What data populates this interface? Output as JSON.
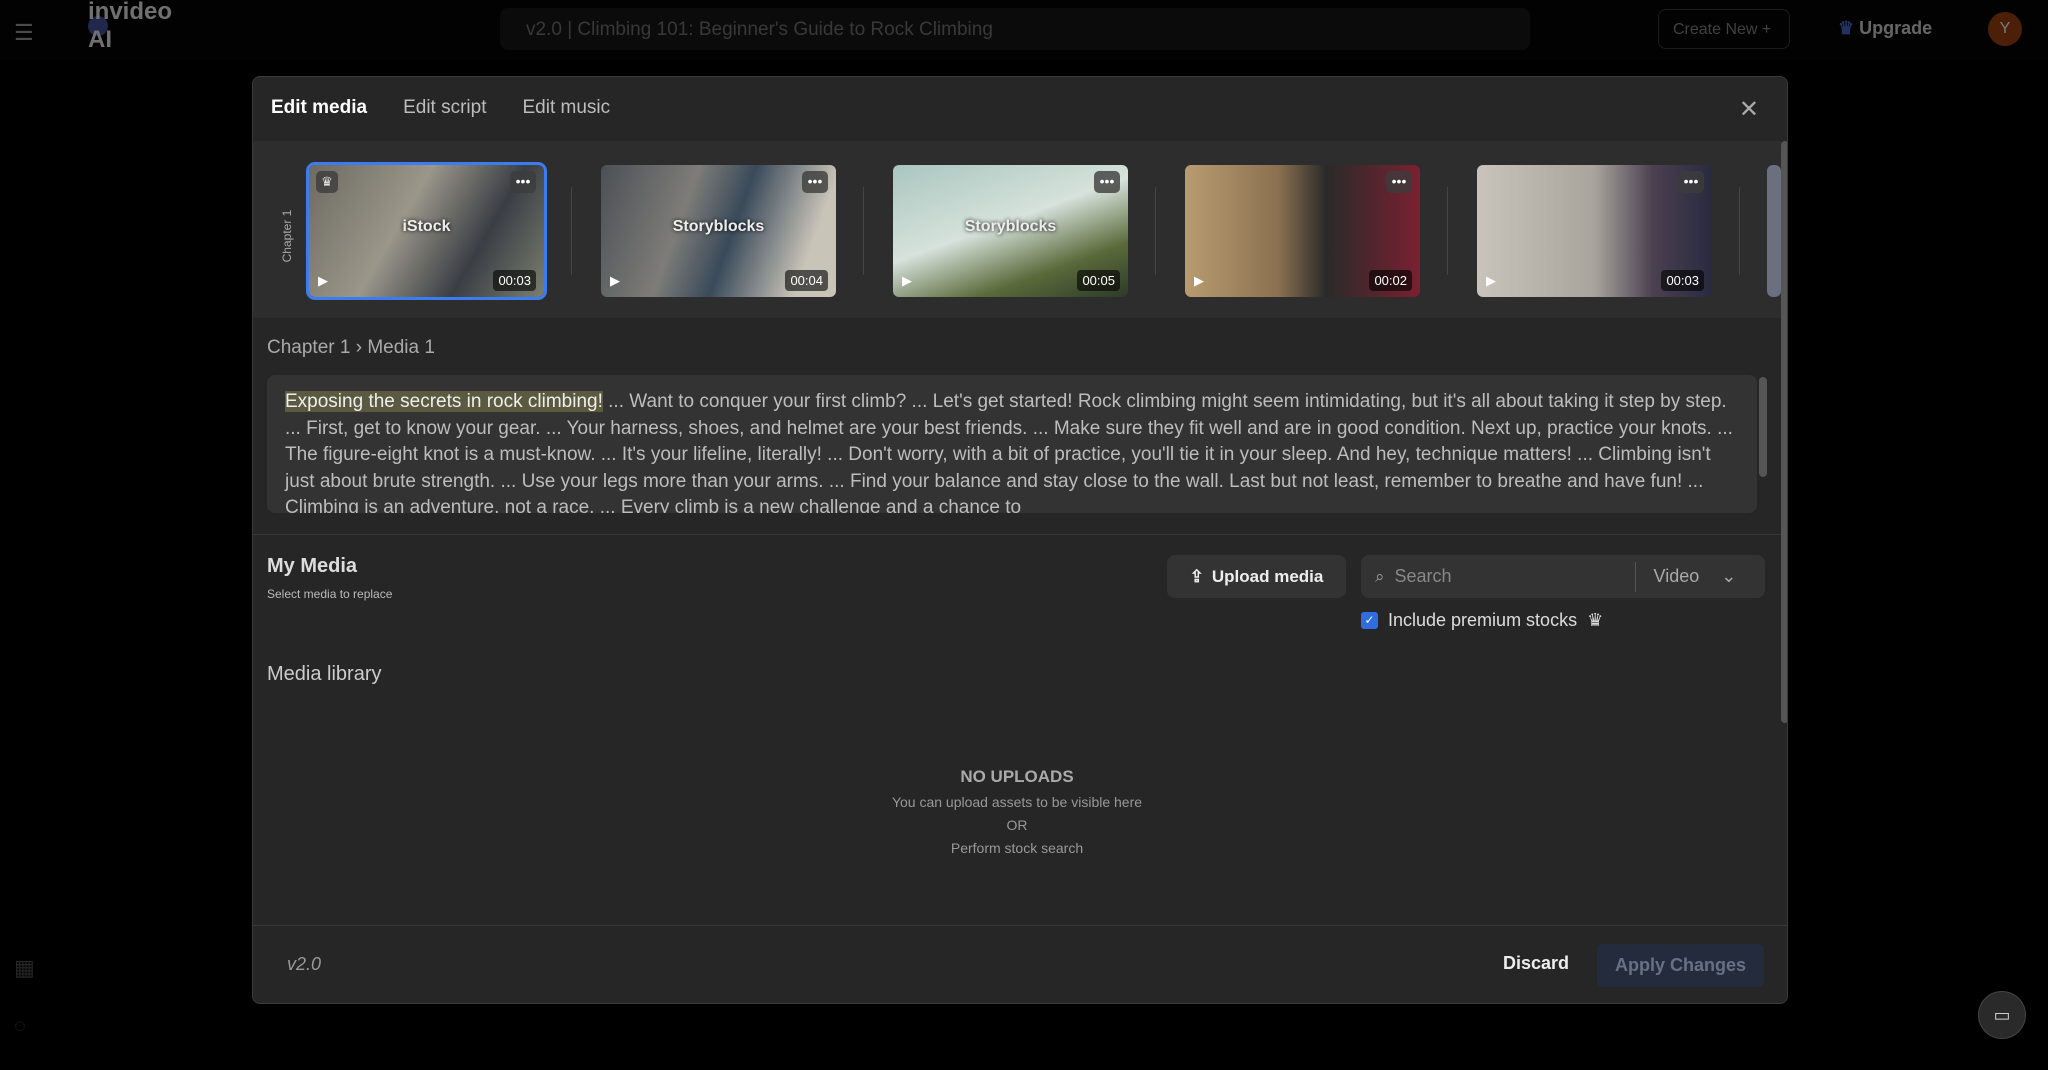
{
  "topbar": {
    "app_name": "invideo AI",
    "project_title": "v2.0 | Climbing 101: Beginner's Guide to Rock Climbing",
    "create_new": "Create New +",
    "upgrade": "Upgrade",
    "avatar_initial": "Y"
  },
  "modal": {
    "tabs": [
      {
        "label": "Edit media"
      },
      {
        "label": "Edit script"
      },
      {
        "label": "Edit music"
      }
    ],
    "chapter_label": "Chapter 1",
    "thumbnails": [
      {
        "source": "iStock",
        "duration": "00:03",
        "premium": true,
        "selected": true
      },
      {
        "source": "Storyblocks",
        "duration": "00:04"
      },
      {
        "source": "Storyblocks",
        "duration": "00:05"
      },
      {
        "source": "",
        "duration": "00:02"
      },
      {
        "source": "",
        "duration": "00:03"
      }
    ],
    "breadcrumb": "Chapter 1 › Media 1",
    "script_highlight": "Exposing the secrets in rock climbing!",
    "script_rest": " ... Want to conquer your first climb? ... Let's get started! Rock climbing might seem intimidating, but it's all about taking it step by step. ... First, get to know your gear. ... Your harness, shoes, and helmet are your best friends. ... Make sure they fit well and are in good condition. Next up, practice your knots. ... The figure-eight knot is a must-know. ... It's your lifeline, literally! ... Don't worry, with a bit of practice, you'll tie it in your sleep. And hey, technique matters! ... Climbing isn't just about brute strength. ... Use your legs more than your arms. ... Find your balance and stay close to the wall. Last but not least, remember to breathe and have fun! ... Climbing is an adventure, not a race. ... Every climb is a new challenge and a chance to",
    "my_media": "My Media",
    "my_media_sub": "Select media to replace",
    "upload_label": "Upload media",
    "search_placeholder": "Search",
    "type_select": "Video",
    "premium_label": "Include premium stocks",
    "premium_checked": true,
    "library_title": "Media library",
    "empty_title": "NO UPLOADS",
    "empty_line1": "You can upload assets to be visible here",
    "empty_or": "OR",
    "empty_line2": "Perform stock search",
    "version": "v2.0",
    "discard": "Discard",
    "apply": "Apply Changes"
  },
  "colors": {
    "accent": "#2f6de1",
    "modal_bg": "#262626"
  }
}
